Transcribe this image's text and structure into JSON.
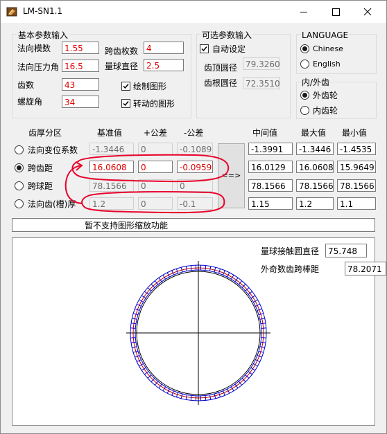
{
  "window": {
    "title": "LM-SN1.1"
  },
  "basic_params": {
    "group_title": "基本参数输入",
    "normal_module": {
      "label": "法向模数",
      "value": "1.55"
    },
    "pressure_angle": {
      "label": "法向压力角",
      "value": "16.5"
    },
    "teeth": {
      "label": "齿数",
      "value": "43"
    },
    "helix_angle": {
      "label": "螺旋角",
      "value": "34"
    },
    "span_teeth": {
      "label": "跨齿枚数",
      "value": "4"
    },
    "ball_diameter": {
      "label": "量球直径",
      "value": "2.5"
    },
    "draw_graph": {
      "label": "绘制图形",
      "checked": true
    },
    "rotate_graph": {
      "label": "转动的图形",
      "checked": true
    }
  },
  "optional_params": {
    "group_title": "可选参数输入",
    "auto_set": {
      "label": "自动设定",
      "checked": true
    },
    "tip_diameter": {
      "label": "齿顶圆径",
      "value": "79.326033"
    },
    "root_diameter": {
      "label": "齿根圆径",
      "value": "72.351033"
    }
  },
  "language": {
    "group_title": "LANGUAGE",
    "options": [
      {
        "label": "Chinese",
        "selected": true
      },
      {
        "label": "English",
        "selected": false
      }
    ]
  },
  "gear_type": {
    "group_title": "内/外齿",
    "options": [
      {
        "label": "外齿轮",
        "selected": true
      },
      {
        "label": "内齿轮",
        "selected": false
      }
    ]
  },
  "thickness": {
    "headers": {
      "category": "齿厚分区",
      "base": "基准值",
      "plus": "+公差",
      "minus": "-公差",
      "mid": "中间值",
      "max": "最大值",
      "min": "最小值"
    },
    "rows": [
      {
        "label": "法向变位系数",
        "selected": false,
        "base": "-1.3446",
        "plus": "0",
        "minus": "-0.1089",
        "mid": "-1.3991",
        "max": "-1.3446",
        "min": "-1.4535"
      },
      {
        "label": "跨齿距",
        "selected": true,
        "base": "16.0608",
        "plus": "0",
        "minus": "-0.0959",
        "mid": "16.0129",
        "max": "16.0608",
        "min": "15.9649"
      },
      {
        "label": "跨球距",
        "selected": false,
        "base": "78.1566",
        "plus": "0",
        "minus": "0",
        "mid": "78.1566",
        "max": "78.1566",
        "min": "78.1566"
      },
      {
        "label": "法向齿(槽)厚",
        "selected": false,
        "base": "1.2",
        "plus": "0",
        "minus": "-0.1",
        "mid": "1.15",
        "max": "1.2",
        "min": "1.1"
      }
    ],
    "calc_button": "==>"
  },
  "status": {
    "text": "暂不支持图形缩放功能"
  },
  "graph": {
    "ball_contact_diameter": {
      "label": "量球接触圆直径",
      "value": "75.748"
    },
    "odd_teeth_over_pins": {
      "label": "外奇数齿跨棒距",
      "value": "78.2071"
    },
    "tooth_count": 43,
    "colors": {
      "outer_ring": "#0000cc",
      "pitch_ring": "#cc0000",
      "axes": "#000000"
    },
    "annotation_color": "#e00000"
  }
}
